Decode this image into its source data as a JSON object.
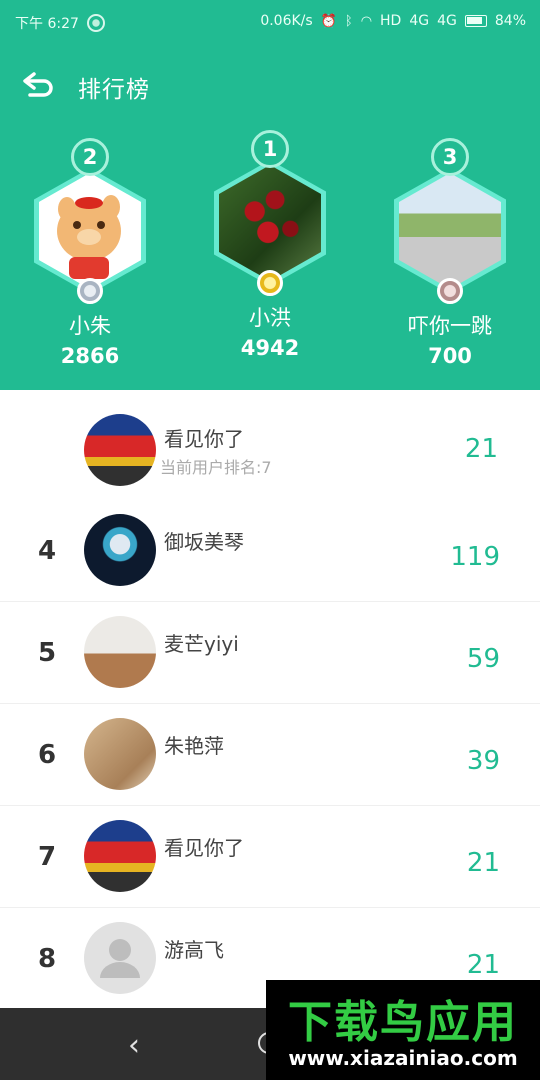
{
  "status_bar": {
    "time": "下午 6:27",
    "net_speed": "0.06K/s",
    "signal_1": "HD",
    "signal_2": "4G",
    "signal_3": "4G",
    "battery": "84%"
  },
  "header": {
    "title": "排行榜"
  },
  "podium": [
    {
      "rank": "2",
      "name": "小朱",
      "score": "2866",
      "medal": "silver"
    },
    {
      "rank": "1",
      "name": "小洪",
      "score": "4942",
      "medal": "gold"
    },
    {
      "rank": "3",
      "name": "吓你一跳",
      "score": "700",
      "medal": "bronze"
    }
  ],
  "current_user": {
    "name": "看见你了",
    "rank_text": "当前用户排名:7",
    "score": "21"
  },
  "list": [
    {
      "rank": "4",
      "name": "御坂美琴",
      "score": "119"
    },
    {
      "rank": "5",
      "name": "麦芒yiyi",
      "score": "59"
    },
    {
      "rank": "6",
      "name": "朱艳萍",
      "score": "39"
    },
    {
      "rank": "7",
      "name": "看见你了",
      "score": "21"
    },
    {
      "rank": "8",
      "name": "游高飞",
      "score": "21"
    }
  ],
  "nav": {
    "back_glyph": "‹"
  },
  "watermark": {
    "brand": "下载鸟应用",
    "url": "www.xiazainiao.com"
  },
  "colors": {
    "accent": "#21bb92",
    "header_bg": "#21bb92"
  }
}
